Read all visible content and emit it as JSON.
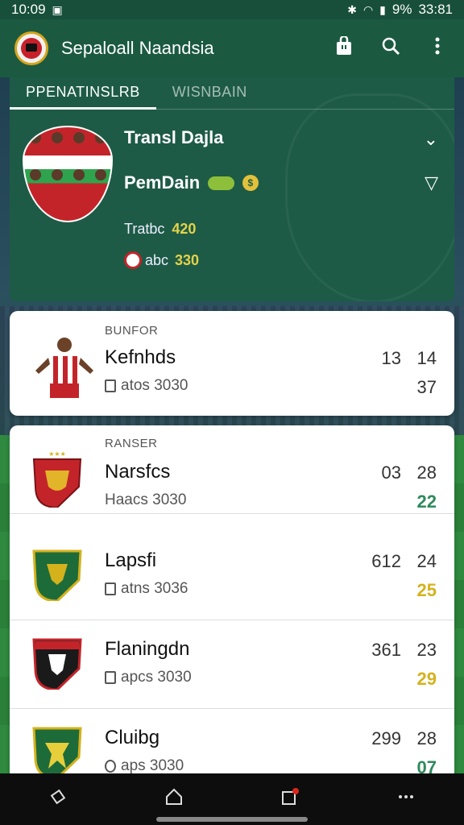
{
  "status_bar": {
    "time": "10:09",
    "battery_text": "9%",
    "right_time": "33:81"
  },
  "app_bar": {
    "title": "Sepaloall Naandsia",
    "actions": [
      "bag-icon",
      "search-icon",
      "more-icon"
    ]
  },
  "hero": {
    "tabs": [
      {
        "label": "PPENATINSLRB",
        "active": true
      },
      {
        "label": "WISNBAIN",
        "active": false
      }
    ],
    "line1": "Transl Dajla",
    "line2": "PemDain",
    "stat1_label": "Tratbc",
    "stat1_value": "420",
    "stat2_label": "abc",
    "stat2_value": "330"
  },
  "sections": [
    {
      "label": "BUNFOR",
      "rows": [
        {
          "name": "Kefnhds",
          "sub": "atos 3030",
          "score1": "13",
          "score2": "14",
          "score3": "37",
          "score3_color": "#333333"
        }
      ]
    },
    {
      "label": "RANSER",
      "rows": [
        {
          "name": "Narsfcs",
          "sub": "Haacs 3030",
          "score1": "03",
          "score2": "28",
          "score3": "22",
          "score3_color": "#2e8a5b",
          "crest_color": "#c3242a"
        },
        {
          "name": "Lapsfi",
          "sub": "atns 3036",
          "score1": "612",
          "score2": "24",
          "score3": "25",
          "score3_color": "#d4b21c",
          "crest_color": "#1e8a3a"
        },
        {
          "name": "Flaningdn",
          "sub": "apcs 3030",
          "score1": "361",
          "score2": "23",
          "score3": "29",
          "score3_color": "#d4b21c",
          "crest_color": "#c3242a"
        },
        {
          "name": "Cluibg",
          "sub": "aps 3030",
          "score1": "299",
          "score2": "28",
          "score3": "07",
          "score3_color": "#2e8a5b",
          "crest_color": "#1e8a3a"
        }
      ]
    }
  ],
  "nav_bar": {
    "items": [
      "back-icon",
      "home-icon",
      "notifications-icon",
      "more-icon"
    ]
  }
}
